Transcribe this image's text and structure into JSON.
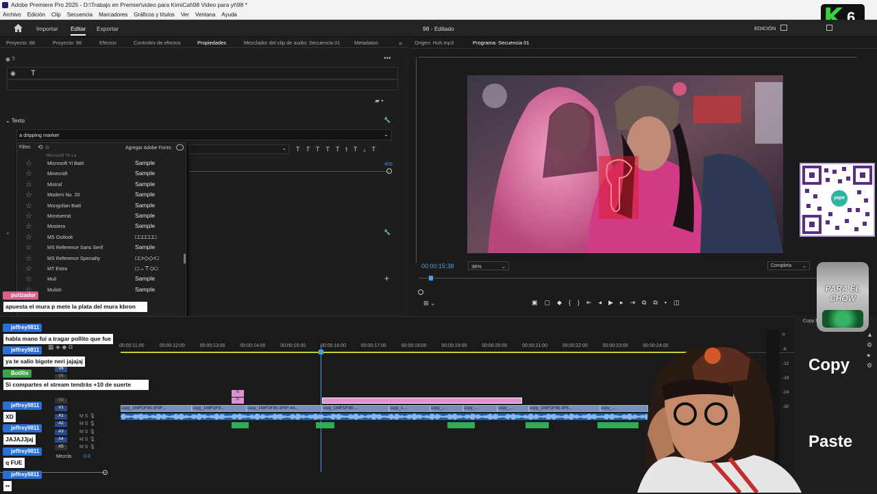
{
  "app": {
    "title": "Adobe Premiere Pro 2025 - D:\\Trabajo en Premier\\video para KimiCat\\98 Video para yt\\98 *"
  },
  "menu": [
    "Archivo",
    "Edición",
    "Clip",
    "Secuencia",
    "Marcadores",
    "Gráficos y títulos",
    "Ver",
    "Ventana",
    "Ayuda"
  ],
  "workspace": {
    "tabs": [
      "Importar",
      "Editar",
      "Exportar"
    ],
    "center": "98 - Editado",
    "right": "EDICIÓN"
  },
  "panel_tabs": [
    "Proyecto: 88",
    "Proyecto: 98",
    "Efectos",
    "Controles de efectos",
    "Propiedades",
    "Mezclador del clip de audio: Secuencia 01",
    "Metadatos"
  ],
  "props": {
    "text_label": "Texto",
    "font_search_value": "a dripping marker",
    "filter_label": "Filtro:",
    "add_adobe_fonts": "Agregar Adobe Fonts:",
    "size_value": "400"
  },
  "fonts": [
    {
      "name": "Microsoft Yi Baiti",
      "sample": "Sample"
    },
    {
      "name": "Minecraft",
      "sample": "Sample"
    },
    {
      "name": "Mistral",
      "sample": "Sample"
    },
    {
      "name": "Modern No. 20",
      "sample": "Sample"
    },
    {
      "name": "Mongolian Baiti",
      "sample": "Sample"
    },
    {
      "name": "Montserrat",
      "sample": "Sample"
    },
    {
      "name": "Mostera",
      "sample": "Sample"
    },
    {
      "name": "MS Outlook",
      "sample": "□□□□□□"
    },
    {
      "name": "MS Reference Sans Serif",
      "sample": "Sample"
    },
    {
      "name": "MS Reference Specialty",
      "sample": "□□▫◇◇▫□"
    },
    {
      "name": "MT Extra",
      "sample": "□→⊤◇□"
    },
    {
      "name": "Muli",
      "sample": "Sample"
    },
    {
      "name": "Mulish",
      "sample": "Sample"
    }
  ],
  "program": {
    "source_tab": "Origen: Huh.mp3",
    "program_tab": "Programa: Secuencia 01",
    "timecode": "00:00:15:38",
    "zoom": "36%",
    "quality": "Completa"
  },
  "timeline": {
    "ruler": [
      "00:00:11:00",
      "00:00:12:00",
      "00:00:13:00",
      "00:00:14:00",
      "00:00:15:00",
      "00:00:16:00",
      "00:00:17:00",
      "00:00:18:00",
      "00:00:19:00",
      "00:00:20:00",
      "00:00:21:00",
      "00:00:22:00",
      "00:00:23:00",
      "00:00:24:00"
    ],
    "clips": [
      "copy_169FDF85-3F8F...",
      "copy_169FDF8...",
      "copy_169FDF85-3F8F-4A...",
      "copy_169FDF85-...",
      "copy_1...",
      "copy_...",
      "copy_...",
      "copy_...",
      "copy_169FDF85-3F8...",
      "copy_..."
    ],
    "tracks_video": [
      "V6",
      "V5",
      "V2",
      "V1"
    ],
    "tracks_audio": [
      "A1",
      "A2",
      "A3",
      "A4",
      "A5"
    ],
    "mix_label": "Mezcla",
    "mix_value": "0.0",
    "meter_ticks": [
      "0",
      "-6",
      "-12",
      "-18",
      "-24",
      "-30"
    ]
  },
  "chat": [
    {
      "user": "putizador",
      "color": "#d95f8c",
      "msg": "apuesta el mura p mete la plata del mura kbron"
    },
    {
      "user": "jeffrey9811",
      "color": "#2a6fd6",
      "msg": "habla mano fui a tragar pollito que fue"
    },
    {
      "user": "jeffrey9811",
      "color": "#2a6fd6",
      "msg": "ya te salio bigote neri jajajaj"
    },
    {
      "user": "BotRix",
      "color": "#3ca34a",
      "msg": "Si compartes el stream tendrás +10 de suerte"
    },
    {
      "user": "jeffrey9811",
      "color": "#2a6fd6",
      "msg": "XD"
    },
    {
      "user": "jeffrey9811",
      "color": "#2a6fd6",
      "msg": "JAJAJJjaj"
    },
    {
      "user": "jeffrey9811",
      "color": "#2a6fd6",
      "msg": "q FUE"
    },
    {
      "user": "jeffrey9811",
      "color": "#2a6fd6",
      "msg": "••"
    }
  ],
  "overlay": {
    "badge_number": "6",
    "badge_letter": "K",
    "jar_text": "PARA EL CHOW",
    "qr_label": "yape",
    "copy": "Copy",
    "paste": "Paste",
    "copy_small": "Copy P"
  },
  "colors": {
    "accent": "#4a90e2",
    "clip_pink": "#e48fd4",
    "fx_purple": "#c66fb9",
    "audio_blue": "#1f5fa4",
    "green": "#2eae54"
  }
}
